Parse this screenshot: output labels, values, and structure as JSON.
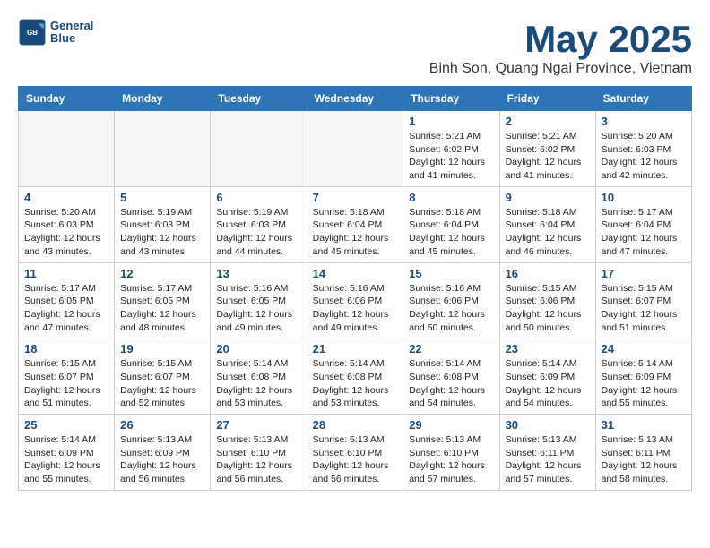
{
  "title": "May 2025",
  "subtitle": "Binh Son, Quang Ngai Province, Vietnam",
  "logo": {
    "line1": "General",
    "line2": "Blue"
  },
  "days_of_week": [
    "Sunday",
    "Monday",
    "Tuesday",
    "Wednesday",
    "Thursday",
    "Friday",
    "Saturday"
  ],
  "weeks": [
    [
      {
        "day": "",
        "empty": true
      },
      {
        "day": "",
        "empty": true
      },
      {
        "day": "",
        "empty": true
      },
      {
        "day": "",
        "empty": true
      },
      {
        "day": "1",
        "info": "Sunrise: 5:21 AM\nSunset: 6:02 PM\nDaylight: 12 hours\nand 41 minutes."
      },
      {
        "day": "2",
        "info": "Sunrise: 5:21 AM\nSunset: 6:02 PM\nDaylight: 12 hours\nand 41 minutes."
      },
      {
        "day": "3",
        "info": "Sunrise: 5:20 AM\nSunset: 6:03 PM\nDaylight: 12 hours\nand 42 minutes."
      }
    ],
    [
      {
        "day": "4",
        "info": "Sunrise: 5:20 AM\nSunset: 6:03 PM\nDaylight: 12 hours\nand 43 minutes."
      },
      {
        "day": "5",
        "info": "Sunrise: 5:19 AM\nSunset: 6:03 PM\nDaylight: 12 hours\nand 43 minutes."
      },
      {
        "day": "6",
        "info": "Sunrise: 5:19 AM\nSunset: 6:03 PM\nDaylight: 12 hours\nand 44 minutes."
      },
      {
        "day": "7",
        "info": "Sunrise: 5:18 AM\nSunset: 6:04 PM\nDaylight: 12 hours\nand 45 minutes."
      },
      {
        "day": "8",
        "info": "Sunrise: 5:18 AM\nSunset: 6:04 PM\nDaylight: 12 hours\nand 45 minutes."
      },
      {
        "day": "9",
        "info": "Sunrise: 5:18 AM\nSunset: 6:04 PM\nDaylight: 12 hours\nand 46 minutes."
      },
      {
        "day": "10",
        "info": "Sunrise: 5:17 AM\nSunset: 6:04 PM\nDaylight: 12 hours\nand 47 minutes."
      }
    ],
    [
      {
        "day": "11",
        "info": "Sunrise: 5:17 AM\nSunset: 6:05 PM\nDaylight: 12 hours\nand 47 minutes."
      },
      {
        "day": "12",
        "info": "Sunrise: 5:17 AM\nSunset: 6:05 PM\nDaylight: 12 hours\nand 48 minutes."
      },
      {
        "day": "13",
        "info": "Sunrise: 5:16 AM\nSunset: 6:05 PM\nDaylight: 12 hours\nand 49 minutes."
      },
      {
        "day": "14",
        "info": "Sunrise: 5:16 AM\nSunset: 6:06 PM\nDaylight: 12 hours\nand 49 minutes."
      },
      {
        "day": "15",
        "info": "Sunrise: 5:16 AM\nSunset: 6:06 PM\nDaylight: 12 hours\nand 50 minutes."
      },
      {
        "day": "16",
        "info": "Sunrise: 5:15 AM\nSunset: 6:06 PM\nDaylight: 12 hours\nand 50 minutes."
      },
      {
        "day": "17",
        "info": "Sunrise: 5:15 AM\nSunset: 6:07 PM\nDaylight: 12 hours\nand 51 minutes."
      }
    ],
    [
      {
        "day": "18",
        "info": "Sunrise: 5:15 AM\nSunset: 6:07 PM\nDaylight: 12 hours\nand 51 minutes."
      },
      {
        "day": "19",
        "info": "Sunrise: 5:15 AM\nSunset: 6:07 PM\nDaylight: 12 hours\nand 52 minutes."
      },
      {
        "day": "20",
        "info": "Sunrise: 5:14 AM\nSunset: 6:08 PM\nDaylight: 12 hours\nand 53 minutes."
      },
      {
        "day": "21",
        "info": "Sunrise: 5:14 AM\nSunset: 6:08 PM\nDaylight: 12 hours\nand 53 minutes."
      },
      {
        "day": "22",
        "info": "Sunrise: 5:14 AM\nSunset: 6:08 PM\nDaylight: 12 hours\nand 54 minutes."
      },
      {
        "day": "23",
        "info": "Sunrise: 5:14 AM\nSunset: 6:09 PM\nDaylight: 12 hours\nand 54 minutes."
      },
      {
        "day": "24",
        "info": "Sunrise: 5:14 AM\nSunset: 6:09 PM\nDaylight: 12 hours\nand 55 minutes."
      }
    ],
    [
      {
        "day": "25",
        "info": "Sunrise: 5:14 AM\nSunset: 6:09 PM\nDaylight: 12 hours\nand 55 minutes."
      },
      {
        "day": "26",
        "info": "Sunrise: 5:13 AM\nSunset: 6:09 PM\nDaylight: 12 hours\nand 56 minutes."
      },
      {
        "day": "27",
        "info": "Sunrise: 5:13 AM\nSunset: 6:10 PM\nDaylight: 12 hours\nand 56 minutes."
      },
      {
        "day": "28",
        "info": "Sunrise: 5:13 AM\nSunset: 6:10 PM\nDaylight: 12 hours\nand 56 minutes."
      },
      {
        "day": "29",
        "info": "Sunrise: 5:13 AM\nSunset: 6:10 PM\nDaylight: 12 hours\nand 57 minutes."
      },
      {
        "day": "30",
        "info": "Sunrise: 5:13 AM\nSunset: 6:11 PM\nDaylight: 12 hours\nand 57 minutes."
      },
      {
        "day": "31",
        "info": "Sunrise: 5:13 AM\nSunset: 6:11 PM\nDaylight: 12 hours\nand 58 minutes."
      }
    ]
  ]
}
